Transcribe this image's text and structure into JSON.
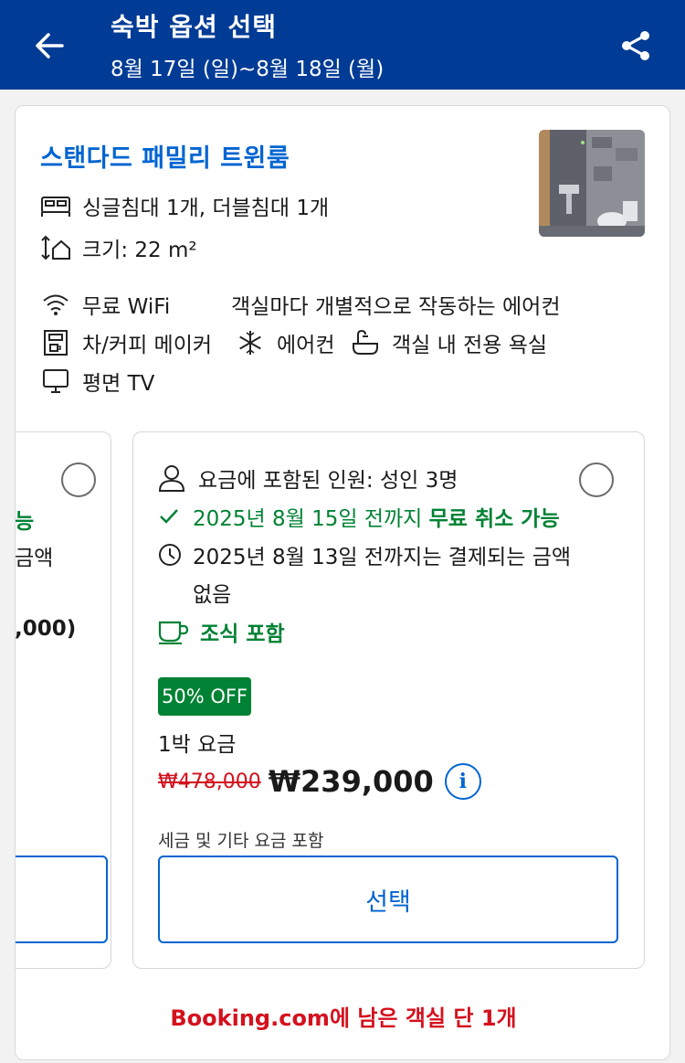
{
  "header": {
    "title": "숙박 옵션 선택",
    "dates": "8월 17일 (일)~8월 18일 (월)",
    "back_icon": "arrow-left-icon",
    "share_icon": "share-icon"
  },
  "room": {
    "name": "스탠다드 패밀리 트윈룸",
    "beds": "싱글침대 1개, 더블침대 1개",
    "size": "크기: 22 m²",
    "amenities": {
      "wifi": "무료 WiFi",
      "ac_individual": "객실마다 개별적으로 작동하는 에어컨",
      "coffee_maker": "차/커피 메이커",
      "aircon": "에어컨",
      "bathroom": "객실 내 전용 욕실",
      "tv": "평면 TV"
    }
  },
  "rate_left_partial": {
    "line1": "능",
    "line2": "금액",
    "line3": ",000)"
  },
  "rate": {
    "occupancy": "요금에 포함된 인원: 성인 3명",
    "cancel_prefix": "2025년 8월 15일 전까지 ",
    "cancel_bold": "무료 취소 가능",
    "payment_line1": "2025년 8월 13일 전까지는 결제되는 금액",
    "payment_line2": "없음",
    "breakfast": "조식 포함",
    "discount": "50% OFF",
    "per_night": "1박 요금",
    "old_price": "₩478,000",
    "new_price": "₩239,000",
    "tax_note": "세금 및 기타 요금 포함",
    "select": "선택"
  },
  "availability": "Booking.com에 남은 객실 단 1개",
  "colors": {
    "brand": "#003b95",
    "link": "#0064d2",
    "green": "#008234",
    "red": "#d4111e"
  }
}
